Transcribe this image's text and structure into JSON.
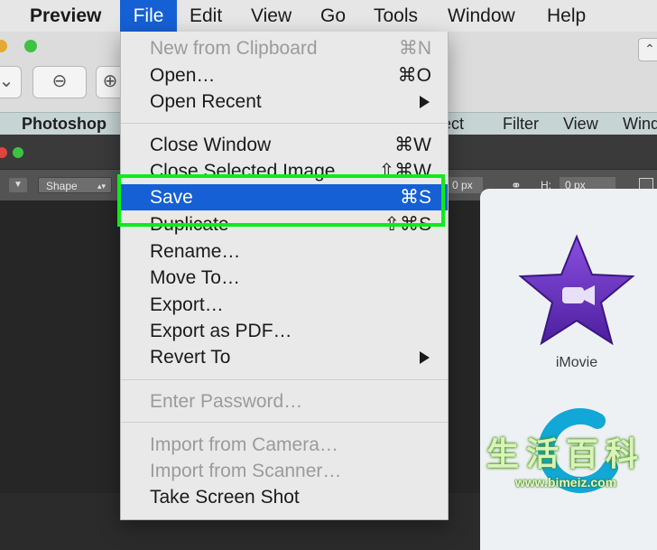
{
  "menubar": {
    "app": "Preview",
    "items": [
      "File",
      "Edit",
      "View",
      "Go",
      "Tools",
      "Window",
      "Help"
    ]
  },
  "preview_toolbar": {
    "chevron": "⌄",
    "zoom_out": "⊖",
    "zoom_in": "⊕",
    "right_button": "⌃"
  },
  "photoshop_menubar": {
    "app": "Photoshop",
    "items": [
      "elect",
      "Filter",
      "View",
      "Wind"
    ]
  },
  "photoshop_options": {
    "shape_label": "Shape",
    "w_value": "0 px",
    "h_label": "H:",
    "h_value": "0 px",
    "link_icon": "link-icon"
  },
  "file_menu": {
    "new_from_clipboard": {
      "label": "New from Clipboard",
      "shortcut": "⌘N"
    },
    "open": {
      "label": "Open…",
      "shortcut": "⌘O"
    },
    "open_recent": {
      "label": "Open Recent"
    },
    "close_window": {
      "label": "Close Window",
      "shortcut": "⌘W"
    },
    "close_selected_image": {
      "label": "Close Selected Image",
      "shortcut": "⇧⌘W"
    },
    "save": {
      "label": "Save",
      "shortcut": "⌘S"
    },
    "duplicate": {
      "label": "Duplicate",
      "shortcut": "⇧⌘S"
    },
    "rename": {
      "label": "Rename…"
    },
    "move_to": {
      "label": "Move To…"
    },
    "export": {
      "label": "Export…"
    },
    "export_pdf": {
      "label": "Export as PDF…"
    },
    "revert_to": {
      "label": "Revert To"
    },
    "enter_password": {
      "label": "Enter Password…"
    },
    "import_camera": {
      "label": "Import from Camera…"
    },
    "import_scanner": {
      "label": "Import from Scanner…"
    },
    "take_screenshot": {
      "label": "Take Screen Shot"
    }
  },
  "apps": {
    "imovie": "iMovie"
  },
  "watermark": {
    "chars": "生活百科",
    "url": "www.bimeiz.com"
  },
  "colors": {
    "highlight": "#1560d4",
    "annotation": "#0bec1a",
    "imovie_purple": "#6b2fc4"
  }
}
